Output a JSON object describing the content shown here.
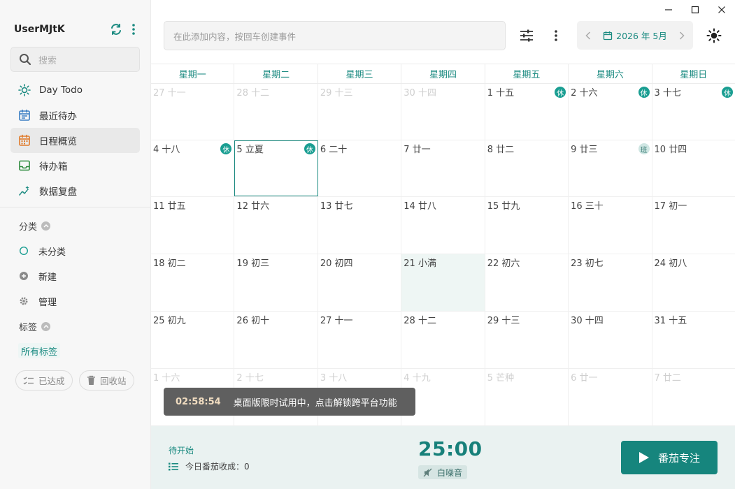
{
  "sidebar": {
    "username": "UserMJtK",
    "search_placeholder": "搜索",
    "nav": [
      {
        "label": "Day Todo",
        "icon": "sun-icon"
      },
      {
        "label": "最近待办",
        "icon": "calendar-list-icon"
      },
      {
        "label": "日程概览",
        "icon": "calendar-grid-icon"
      },
      {
        "label": "待办箱",
        "icon": "inbox-icon"
      },
      {
        "label": "数据复盘",
        "icon": "sparkle-chart-icon"
      }
    ],
    "category_header": "分类",
    "categories": [
      {
        "label": "未分类",
        "icon": "circle-outline-icon"
      },
      {
        "label": "新建",
        "icon": "plus-circle-icon"
      },
      {
        "label": "管理",
        "icon": "gear-icon"
      }
    ],
    "tag_header": "标签",
    "all_tags": "所有标签",
    "done_label": "已达成",
    "trash_label": "回收站"
  },
  "topbar": {
    "add_placeholder": "在此添加内容，按回车创建事件",
    "month_label": "2026 年 5月"
  },
  "calendar": {
    "weekdays": [
      "星期一",
      "星期二",
      "星期三",
      "星期四",
      "星期五",
      "星期六",
      "星期日"
    ],
    "weeks": [
      [
        {
          "date": "27 十一",
          "other": true
        },
        {
          "date": "28 十二",
          "other": true
        },
        {
          "date": "29 十三",
          "other": true
        },
        {
          "date": "30 十四",
          "other": true
        },
        {
          "date": "1 十五",
          "badge": "休"
        },
        {
          "date": "2 十六",
          "badge": "休"
        },
        {
          "date": "3 十七",
          "badge": "休"
        }
      ],
      [
        {
          "date": "4 十八",
          "badge": "休"
        },
        {
          "date": "5 立夏",
          "badge": "休",
          "selected": true
        },
        {
          "date": "6 二十"
        },
        {
          "date": "7 廿一"
        },
        {
          "date": "8 廿二"
        },
        {
          "date": "9 廿三",
          "badge": "班",
          "badge_type": "work"
        },
        {
          "date": "10 廿四"
        }
      ],
      [
        {
          "date": "11 廿五"
        },
        {
          "date": "12 廿六"
        },
        {
          "date": "13 廿七"
        },
        {
          "date": "14 廿八"
        },
        {
          "date": "15 廿九"
        },
        {
          "date": "16 三十"
        },
        {
          "date": "17 初一"
        }
      ],
      [
        {
          "date": "18 初二"
        },
        {
          "date": "19 初三"
        },
        {
          "date": "20 初四"
        },
        {
          "date": "21 小满",
          "today": true
        },
        {
          "date": "22 初六"
        },
        {
          "date": "23 初七"
        },
        {
          "date": "24 初八"
        }
      ],
      [
        {
          "date": "25 初九"
        },
        {
          "date": "26 初十"
        },
        {
          "date": "27 十一"
        },
        {
          "date": "28 十二"
        },
        {
          "date": "29 十三"
        },
        {
          "date": "30 十四"
        },
        {
          "date": "31 十五"
        }
      ],
      [
        {
          "date": "1 十六",
          "other": true
        },
        {
          "date": "2 十七",
          "other": true
        },
        {
          "date": "3 十八",
          "other": true
        },
        {
          "date": "4 十九",
          "other": true
        },
        {
          "date": "5 芒种",
          "other": true
        },
        {
          "date": "6 廿一",
          "other": true
        },
        {
          "date": "7 廿二",
          "other": true
        }
      ]
    ]
  },
  "toast": {
    "time": "02:58:54",
    "message": "桌面版限时试用中，点击解锁跨平台功能"
  },
  "pomodoro": {
    "status": "待开始",
    "harvest": "今日番茄收成：0",
    "timer": "25:00",
    "noise_label": "白噪音",
    "focus_button": "番茄专注"
  },
  "colors": {
    "accent": "#1a8a80",
    "badge": "#1a9e92"
  }
}
